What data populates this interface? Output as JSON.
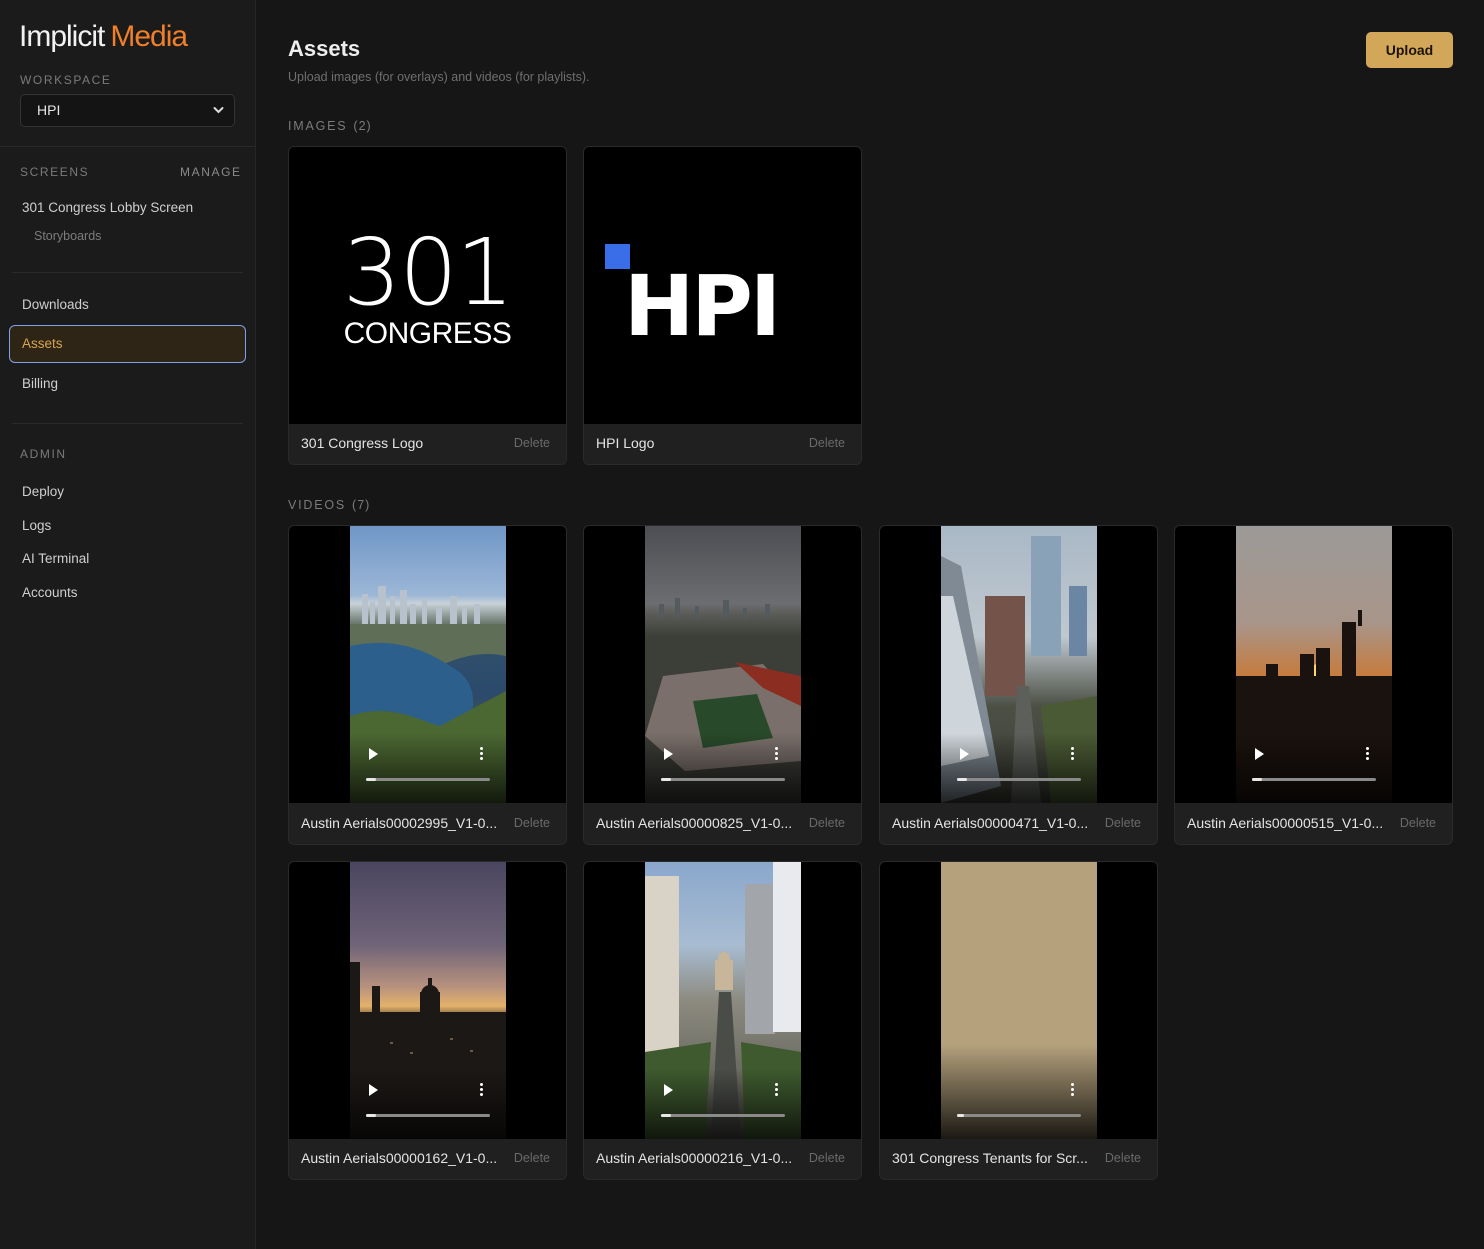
{
  "brand": {
    "name_white": "Implicit",
    "name_orange": "Media"
  },
  "sidebar": {
    "workspace_label": "WORKSPACE",
    "workspace_value": "HPI",
    "screens_label": "SCREENS",
    "manage_label": "MANAGE",
    "screen_name": "301 Congress Lobby Screen",
    "screen_sub": "Storyboards",
    "nav": [
      "Downloads",
      "Assets",
      "Billing"
    ],
    "admin_label": "ADMIN",
    "admin_items": [
      "Deploy",
      "Logs",
      "AI Terminal",
      "Accounts"
    ]
  },
  "header": {
    "title": "Assets",
    "subtitle": "Upload images (for overlays) and videos (for playlists).",
    "upload_label": "Upload"
  },
  "images": {
    "label": "IMAGES",
    "count": "(2)",
    "items": [
      {
        "name": "301 Congress Logo",
        "delete": "Delete",
        "logo_num": "301",
        "logo_word": "CONGRESS"
      },
      {
        "name": "HPI Logo",
        "delete": "Delete",
        "logo_word": "HPI"
      }
    ]
  },
  "videos": {
    "label": "VIDEOS",
    "count": "(7)",
    "items": [
      {
        "name": "Austin Aerials00002995_V1-0...",
        "delete": "Delete",
        "progress": 0.08
      },
      {
        "name": "Austin Aerials00000825_V1-0...",
        "delete": "Delete",
        "progress": 0.08
      },
      {
        "name": "Austin Aerials00000471_V1-0...",
        "delete": "Delete",
        "progress": 0.08
      },
      {
        "name": "Austin Aerials00000515_V1-0...",
        "delete": "Delete",
        "progress": 0.08
      },
      {
        "name": "Austin Aerials00000162_V1-0...",
        "delete": "Delete",
        "progress": 0.08
      },
      {
        "name": "Austin Aerials00000216_V1-0...",
        "delete": "Delete",
        "progress": 0.08
      },
      {
        "name": "301 Congress Tenants for Scr...",
        "delete": "Delete",
        "progress": 0.06
      }
    ]
  },
  "colors": {
    "accent": "#d3a75a",
    "brand_orange": "#f07f2a",
    "active_border": "#7da2e8"
  }
}
